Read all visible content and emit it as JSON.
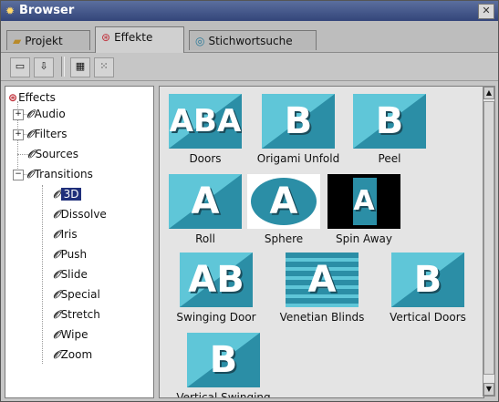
{
  "window": {
    "title": "Browser",
    "close_glyph": "✕"
  },
  "tabs": [
    {
      "label": "Projekt",
      "icon": "folder-icon"
    },
    {
      "label": "Effekte",
      "icon": "effects-icon",
      "active": true
    },
    {
      "label": "Stichwortsuche",
      "icon": "search-globe-icon"
    }
  ],
  "toolbar": {
    "buttons": [
      "view-list-icon",
      "sort-icon",
      "grid-icon",
      "grid-options-icon"
    ]
  },
  "tree": {
    "root": "Effects",
    "items": [
      {
        "label": "Audio",
        "expandable": true
      },
      {
        "label": "Filters",
        "expandable": true
      },
      {
        "label": "Sources",
        "expandable": false
      },
      {
        "label": "Transitions",
        "expandable": true,
        "expanded": true
      }
    ],
    "transitions": [
      {
        "label": "3D",
        "selected": true
      },
      {
        "label": "Dissolve"
      },
      {
        "label": "Iris"
      },
      {
        "label": "Push"
      },
      {
        "label": "Slide"
      },
      {
        "label": "Special"
      },
      {
        "label": "Stretch"
      },
      {
        "label": "Wipe"
      },
      {
        "label": "Zoom"
      }
    ]
  },
  "effects": [
    {
      "label": "Doors",
      "glyph": "ABA"
    },
    {
      "label": "Origami Unfold",
      "glyph": "B"
    },
    {
      "label": "Peel",
      "glyph": "B"
    },
    {
      "label": "Roll",
      "glyph": "A"
    },
    {
      "label": "Sphere",
      "glyph": "A"
    },
    {
      "label": "Spin Away",
      "glyph": "A"
    },
    {
      "label": "Swinging Door",
      "glyph": "AB"
    },
    {
      "label": "Venetian Blinds",
      "glyph": "A"
    },
    {
      "label": "Vertical Doors",
      "glyph": "B"
    },
    {
      "label": "Vertical Swinging",
      "glyph": "B"
    }
  ],
  "colors": {
    "thumb_dark": "#2b8ea6",
    "thumb_light": "#5fc6d8",
    "selection": "#1f2f7a",
    "titlebar": "#3a4c80"
  }
}
